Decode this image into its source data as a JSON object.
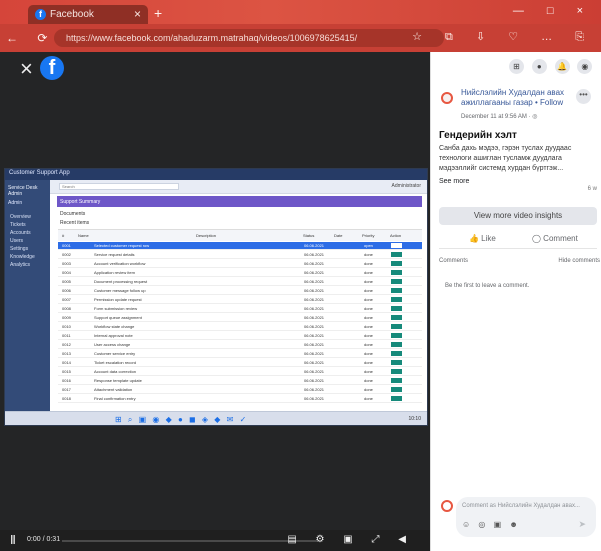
{
  "browser": {
    "tab_title": "Facebook",
    "tab_close": "×",
    "new_tab": "+",
    "url": "https://www.facebook.com/ahaduzarm.matrahaq/videos/1006978625415/",
    "nav_icons": "← ⟳",
    "window_controls": "— □ ×",
    "toolbar_icons": "☆ ⧉ ⇩ ♡ … ⎘"
  },
  "viewer": {
    "close": "×",
    "logo": "f",
    "inner_app": {
      "title": "Customer Support App",
      "brand": "Service Desk Admin",
      "section": "Admin",
      "sidebar_items": [
        "Overview",
        "Tickets",
        "Accounts",
        "Users",
        "Settings",
        "Knowledge",
        "Analytics"
      ],
      "search": "Search",
      "user": "Administrator",
      "header_bar": "Support Summary",
      "tab": "Documents",
      "filter": "Recent items",
      "columns": [
        "#",
        "Name",
        "Description",
        "Status",
        "Date",
        "Priority",
        "Action"
      ],
      "rows": [
        {
          "id": "0001",
          "text": "Selected customer request row",
          "date": "06.06.2021",
          "status": "open"
        },
        {
          "id": "0002",
          "text": "Service request details",
          "date": "06.06.2021",
          "status": "done"
        },
        {
          "id": "0003",
          "text": "Account verification workflow",
          "date": "06.06.2021",
          "status": "done"
        },
        {
          "id": "0004",
          "text": "Application review item",
          "date": "06.06.2021",
          "status": "done"
        },
        {
          "id": "0005",
          "text": "Document processing request",
          "date": "06.06.2021",
          "status": "done"
        },
        {
          "id": "0006",
          "text": "Customer message follow up",
          "date": "06.06.2021",
          "status": "done"
        },
        {
          "id": "0007",
          "text": "Permission update request",
          "date": "06.06.2021",
          "status": "done"
        },
        {
          "id": "0008",
          "text": "Form submission review",
          "date": "06.06.2021",
          "status": "done"
        },
        {
          "id": "0009",
          "text": "Support queue assignment",
          "date": "06.06.2021",
          "status": "done"
        },
        {
          "id": "0010",
          "text": "Workflow state change",
          "date": "06.06.2021",
          "status": "done"
        },
        {
          "id": "0011",
          "text": "Internal approval note",
          "date": "06.06.2021",
          "status": "done"
        },
        {
          "id": "0012",
          "text": "User access change",
          "date": "06.06.2021",
          "status": "done"
        },
        {
          "id": "0013",
          "text": "Customer service entry",
          "date": "06.06.2021",
          "status": "done"
        },
        {
          "id": "0014",
          "text": "Ticket escalation record",
          "date": "06.06.2021",
          "status": "done"
        },
        {
          "id": "0015",
          "text": "Account data correction",
          "date": "06.06.2021",
          "status": "done"
        },
        {
          "id": "0016",
          "text": "Response template update",
          "date": "06.06.2021",
          "status": "done"
        },
        {
          "id": "0017",
          "text": "Attachment validation",
          "date": "06.06.2021",
          "status": "done"
        },
        {
          "id": "0018",
          "text": "Final confirmation entry",
          "date": "06.06.2021",
          "status": "done"
        }
      ],
      "taskbar_icons": "⊞ ⌕ ▣ ◉ ◆ ● ◼ ◈ ◆ ✉ ✓",
      "taskbar_time": "10:10"
    },
    "controls": {
      "play": "Ⅱ",
      "time": "0:00 / 0:31",
      "progress_fraction": 0.0,
      "icons": "▤ ⚙ ▣ ⤢ ◀"
    }
  },
  "panel": {
    "top_icons": [
      "⊞",
      "●",
      "🔔",
      "◉"
    ],
    "author": "Нийслэлийн Худалдан авах ажиллагааны газар • Follow",
    "date": "December 11 at 9:56 AM · ◎",
    "more": "•••",
    "title": "Гендерийн хэлт",
    "body": "Санба дахь мэдээ, гэрэн туслах дуудаас технологи ашиглан тусламж дуудлага мэдээллийг системд хурдан бүртгэж...",
    "see_more": "See more",
    "meta": "6 w",
    "insights_button": "View more video insights",
    "like": "👍 Like",
    "comment": "◯ Comment",
    "comments_label": "Comments",
    "hide_comments": "Hide comments",
    "first_comment": "Be the first to leave a comment.",
    "comment_placeholder": "Comment as Нийслэлийн Худалдан авах...",
    "comment_tools": "☺ ◎ ▣ ☻",
    "send": "➤"
  }
}
